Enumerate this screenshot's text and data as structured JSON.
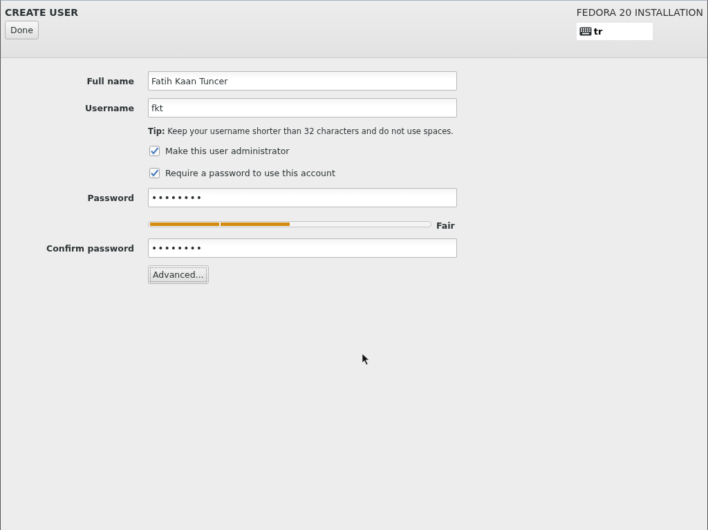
{
  "header": {
    "title": "CREATE USER",
    "done_button": "Done",
    "product": "FEDORA 20 INSTALLATION",
    "keyboard_layout": "tr"
  },
  "fields": [
    {
      "label": "Full name",
      "value": "Fatih Kaan Tuncer"
    },
    {
      "label": "Username",
      "value": "fkt"
    }
  ],
  "tip": "**Tip:** Keep your username shorter than 32 characters and do not use spaces.",
  "checkboxes": [
    {
      "label": "Make this user administrator",
      "checked": true
    },
    {
      "label": "Require a password to use this account",
      "checked": true
    }
  ],
  "password": {
    "label": "Password",
    "value": "••••••••"
  },
  "strength": {
    "level": 0.5,
    "reading": "Fair"
  },
  "confirm": {
    "label": "Confirm password",
    "value": "••••••••"
  },
  "advanced_button": "Advanced..."
}
